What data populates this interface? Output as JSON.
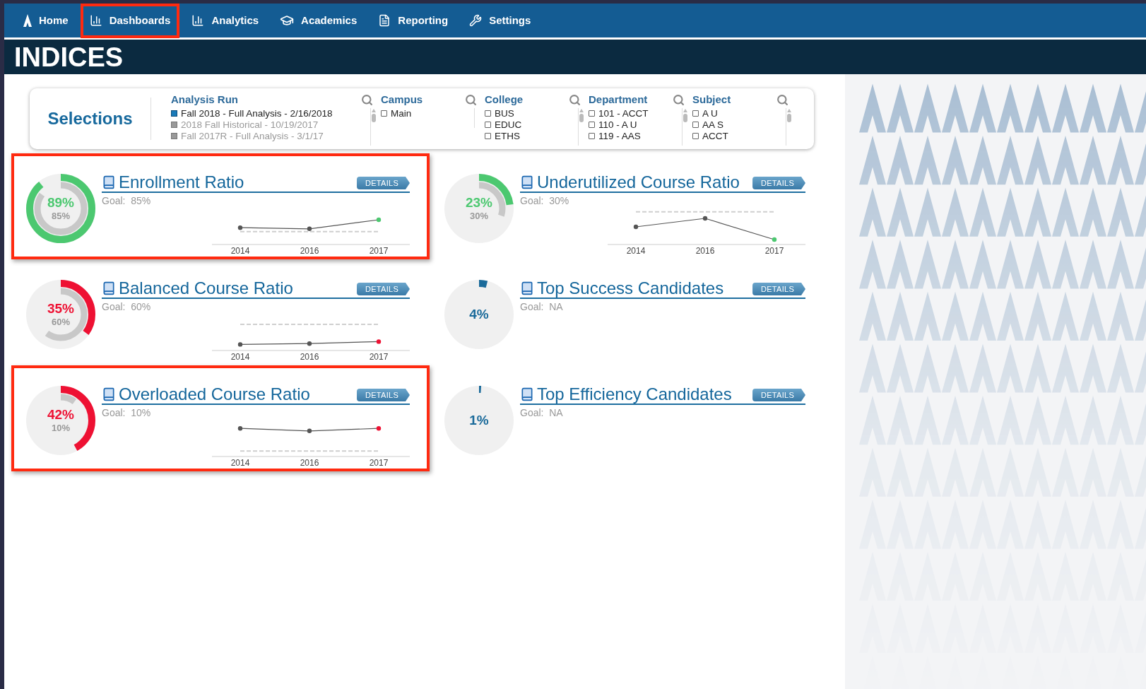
{
  "nav": [
    {
      "label": "Home",
      "highlighted": false
    },
    {
      "label": "Dashboards",
      "highlighted": true
    },
    {
      "label": "Analytics",
      "highlighted": false
    },
    {
      "label": "Academics",
      "highlighted": false
    },
    {
      "label": "Reporting",
      "highlighted": false
    },
    {
      "label": "Settings",
      "highlighted": false
    }
  ],
  "page_title": "INDICES",
  "selections": {
    "title": "Selections",
    "filters": [
      {
        "title": "Analysis Run",
        "kind": "run",
        "items": [
          {
            "label": "Fall 2018 - Full Analysis - 2/16/2018",
            "selected": true
          },
          {
            "label": "2018 Fall Historical - 10/19/2017",
            "selected": false
          },
          {
            "label": "Fall 2017R - Full Analysis - 3/1/17",
            "selected": false
          }
        ]
      },
      {
        "title": "Campus",
        "kind": "check",
        "items": [
          {
            "label": "Main",
            "checked": false
          }
        ]
      },
      {
        "title": "College",
        "kind": "check",
        "items": [
          {
            "label": "BUS",
            "checked": false
          },
          {
            "label": "EDUC",
            "checked": false
          },
          {
            "label": "ETHS",
            "checked": false
          }
        ]
      },
      {
        "title": "Department",
        "kind": "check",
        "items": [
          {
            "label": "101 - ACCT",
            "checked": false
          },
          {
            "label": "110 - A U",
            "checked": false
          },
          {
            "label": "119 - AAS",
            "checked": false
          }
        ]
      },
      {
        "title": "Subject",
        "kind": "check",
        "items": [
          {
            "label": "A U",
            "checked": false
          },
          {
            "label": "AA S",
            "checked": false
          },
          {
            "label": "ACCT",
            "checked": false
          }
        ]
      }
    ]
  },
  "cards": [
    {
      "title": "Enrollment Ratio",
      "goal": "Goal:  85%",
      "button": "DETAILS",
      "highlighted": true,
      "gauge": {
        "value": "89%",
        "goal": "85%",
        "level": 0.89,
        "color": "#4cc870",
        "goal_ring": {
          "level": 0.85
        }
      },
      "chart": {
        "years": [
          "2014",
          "2016",
          "2017"
        ]
      }
    },
    {
      "title": "Underutilized Course Ratio",
      "goal": "Goal:  30%",
      "button": "DETAILS",
      "highlighted": false,
      "gauge": {
        "value": "23%",
        "goal": "30%",
        "level": 0.23,
        "color": "#4cc870",
        "goal_ring": {
          "level": 0.3
        }
      },
      "chart": {
        "years": [
          "2014",
          "2016",
          "2017"
        ]
      }
    },
    {
      "title": "Balanced Course Ratio",
      "goal": "Goal:  60%",
      "button": "DETAILS",
      "highlighted": false,
      "gauge": {
        "value": "35%",
        "goal": "60%",
        "level": 0.35,
        "color": "#ee1133",
        "goal_ring": {
          "level": 0.6
        }
      },
      "chart": {
        "years": [
          "2014",
          "2016",
          "2017"
        ]
      }
    },
    {
      "title": "Top Success Candidates",
      "goal": "Goal:  NA",
      "button": "DETAILS",
      "highlighted": false,
      "gauge": {
        "value": "4%",
        "level": 0.04,
        "color": "#1a6a9a"
      }
    },
    {
      "title": "Overloaded Course Ratio",
      "goal": "Goal:  10%",
      "button": "DETAILS",
      "highlighted": true,
      "gauge": {
        "value": "42%",
        "goal": "10%",
        "level": 0.42,
        "color": "#ee1133",
        "goal_ring": {
          "level": 0.1
        }
      },
      "chart": {
        "years": [
          "2014",
          "2016",
          "2017"
        ]
      }
    },
    {
      "title": "Top Efficiency Candidates",
      "goal": "Goal:  NA",
      "button": "DETAILS",
      "highlighted": false,
      "gauge": {
        "value": "1%",
        "level": 0.01,
        "color": "#1a6a9a"
      }
    }
  ]
}
